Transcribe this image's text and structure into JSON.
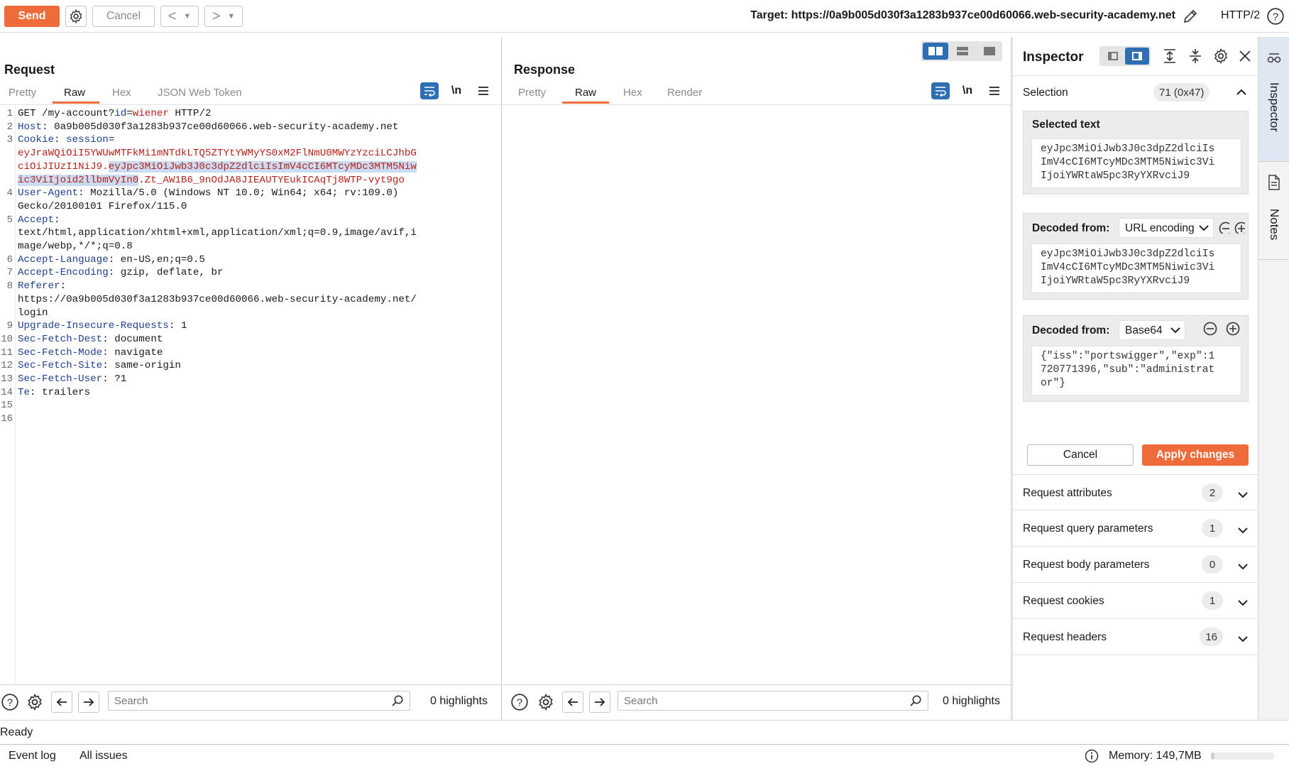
{
  "toolbar": {
    "send_label": "Send",
    "cancel_label": "Cancel",
    "target": "Target: https://0a9b005d030f3a1283b937ce00d60066.web-security-academy.net",
    "protocol": "HTTP/2"
  },
  "request": {
    "title": "Request",
    "tabs": [
      "Pretty",
      "Raw",
      "Hex",
      "JSON Web Token"
    ],
    "active_tab": "Raw",
    "newline_label": "\\n",
    "lines": [
      {
        "n": "1",
        "parts": [
          [
            "",
            "GET /my-account?"
          ],
          [
            "qp",
            "id"
          ],
          [
            "",
            "="
          ],
          [
            "red",
            "wiener"
          ],
          [
            "",
            " HTTP/2"
          ]
        ]
      },
      {
        "n": "2",
        "parts": [
          [
            "hk",
            "Host"
          ],
          [
            "",
            ": 0a9b005d030f3a1283b937ce00d60066.web-security-academy.net"
          ]
        ]
      },
      {
        "n": "3",
        "parts": [
          [
            "hk",
            "Cookie"
          ],
          [
            "",
            ": "
          ],
          [
            "hk",
            "session"
          ],
          [
            "",
            "="
          ]
        ]
      },
      {
        "n": "",
        "parts": [
          [
            "red",
            "eyJraWQiOiI5YWUwMTFkMi1mNTdkLTQ5ZTYtYWMyYS0xM2FlNmU0MWYzYzciLCJhbG"
          ]
        ]
      },
      {
        "n": "",
        "parts": [
          [
            "red",
            "ciOiJIUzI1NiJ9."
          ],
          [
            "red sel",
            "eyJpc3MiOiJwb3J0c3dpZ2dlciIsImV4cCI6MTcyMDc3MTM5Niw"
          ]
        ]
      },
      {
        "n": "",
        "parts": [
          [
            "red sel",
            "ic3ViIjoid2llbmVyIn0"
          ],
          [
            "red",
            ".Zt_AW1B6_9nOdJA8JIEAUTYEukICAqTj8WTP-vyt9go"
          ]
        ]
      },
      {
        "n": "4",
        "parts": [
          [
            "hk",
            "User-Agent"
          ],
          [
            "",
            ": Mozilla/5.0 (Windows NT 10.0; Win64; x64; rv:109.0)"
          ]
        ]
      },
      {
        "n": "",
        "parts": [
          [
            "",
            "Gecko/20100101 Firefox/115.0"
          ]
        ]
      },
      {
        "n": "5",
        "parts": [
          [
            "hk",
            "Accept"
          ],
          [
            "",
            ":"
          ]
        ]
      },
      {
        "n": "",
        "parts": [
          [
            "",
            "text/html,application/xhtml+xml,application/xml;q=0.9,image/avif,i"
          ]
        ]
      },
      {
        "n": "",
        "parts": [
          [
            "",
            "mage/webp,*/*;q=0.8"
          ]
        ]
      },
      {
        "n": "6",
        "parts": [
          [
            "hk",
            "Accept-Language"
          ],
          [
            "",
            ": en-US,en;q=0.5"
          ]
        ]
      },
      {
        "n": "7",
        "parts": [
          [
            "hk",
            "Accept-Encoding"
          ],
          [
            "",
            ": gzip, deflate, br"
          ]
        ]
      },
      {
        "n": "8",
        "parts": [
          [
            "hk",
            "Referer"
          ],
          [
            "",
            ":"
          ]
        ]
      },
      {
        "n": "",
        "parts": [
          [
            "",
            "https://0a9b005d030f3a1283b937ce00d60066.web-security-academy.net/"
          ]
        ]
      },
      {
        "n": "",
        "parts": [
          [
            "",
            "login"
          ]
        ]
      },
      {
        "n": "9",
        "parts": [
          [
            "hk",
            "Upgrade-Insecure-Requests"
          ],
          [
            "",
            ": 1"
          ]
        ]
      },
      {
        "n": "10",
        "parts": [
          [
            "hk",
            "Sec-Fetch-Dest"
          ],
          [
            "",
            ": document"
          ]
        ]
      },
      {
        "n": "11",
        "parts": [
          [
            "hk",
            "Sec-Fetch-Mode"
          ],
          [
            "",
            ": navigate"
          ]
        ]
      },
      {
        "n": "12",
        "parts": [
          [
            "hk",
            "Sec-Fetch-Site"
          ],
          [
            "",
            ": same-origin"
          ]
        ]
      },
      {
        "n": "13",
        "parts": [
          [
            "hk",
            "Sec-Fetch-User"
          ],
          [
            "",
            ": ?1"
          ]
        ]
      },
      {
        "n": "14",
        "parts": [
          [
            "hk",
            "Te"
          ],
          [
            "",
            ": trailers"
          ]
        ]
      },
      {
        "n": "15",
        "parts": [
          [
            "",
            ""
          ]
        ]
      },
      {
        "n": "16",
        "parts": [
          [
            "",
            ""
          ]
        ]
      }
    ],
    "search_placeholder": "Search",
    "highlights": "0 highlights"
  },
  "response": {
    "title": "Response",
    "tabs": [
      "Pretty",
      "Raw",
      "Hex",
      "Render"
    ],
    "active_tab": "Raw",
    "newline_label": "\\n",
    "search_placeholder": "Search",
    "highlights": "0 highlights"
  },
  "inspector": {
    "title": "Inspector",
    "selection_label": "Selection",
    "selection_value": "71 (0x47)",
    "selected_text_label": "Selected text",
    "selected_text": "eyJpc3MiOiJwb3J0c3dpZ2dlciIs\nImV4cCI6MTcyMDc3MTM5Niwic3Vi\nIjoiYWRtaW5pc3RyYXRvciJ9",
    "decoded1_label": "Decoded from:",
    "decoded1_type": "URL encoding",
    "decoded1_text": "eyJpc3MiOiJwb3J0c3dpZ2dlciIs\nImV4cCI6MTcyMDc3MTM5Niwic3Vi\nIjoiYWRtaW5pc3RyYXRvciJ9",
    "decoded2_label": "Decoded from:",
    "decoded2_type": "Base64",
    "decoded2_text": "{\"iss\":\"portswigger\",\"exp\":1\n720771396,\"sub\":\"administrat\nor\"}",
    "cancel_label": "Cancel",
    "apply_label": "Apply changes",
    "sections": [
      {
        "label": "Request attributes",
        "count": "2"
      },
      {
        "label": "Request query parameters",
        "count": "1"
      },
      {
        "label": "Request body parameters",
        "count": "0"
      },
      {
        "label": "Request cookies",
        "count": "1"
      },
      {
        "label": "Request headers",
        "count": "16"
      }
    ]
  },
  "rail": {
    "inspector_label": "Inspector",
    "notes_label": "Notes"
  },
  "status": {
    "ready": "Ready",
    "event_log": "Event log",
    "all_issues": "All issues",
    "memory": "Memory: 149,7MB"
  },
  "colors": {
    "accent": "#ef6c3a",
    "blue": "#2e6fb4",
    "header_key": "#21418f",
    "value_red": "#b8231c",
    "selection": "#c9dcf3"
  }
}
